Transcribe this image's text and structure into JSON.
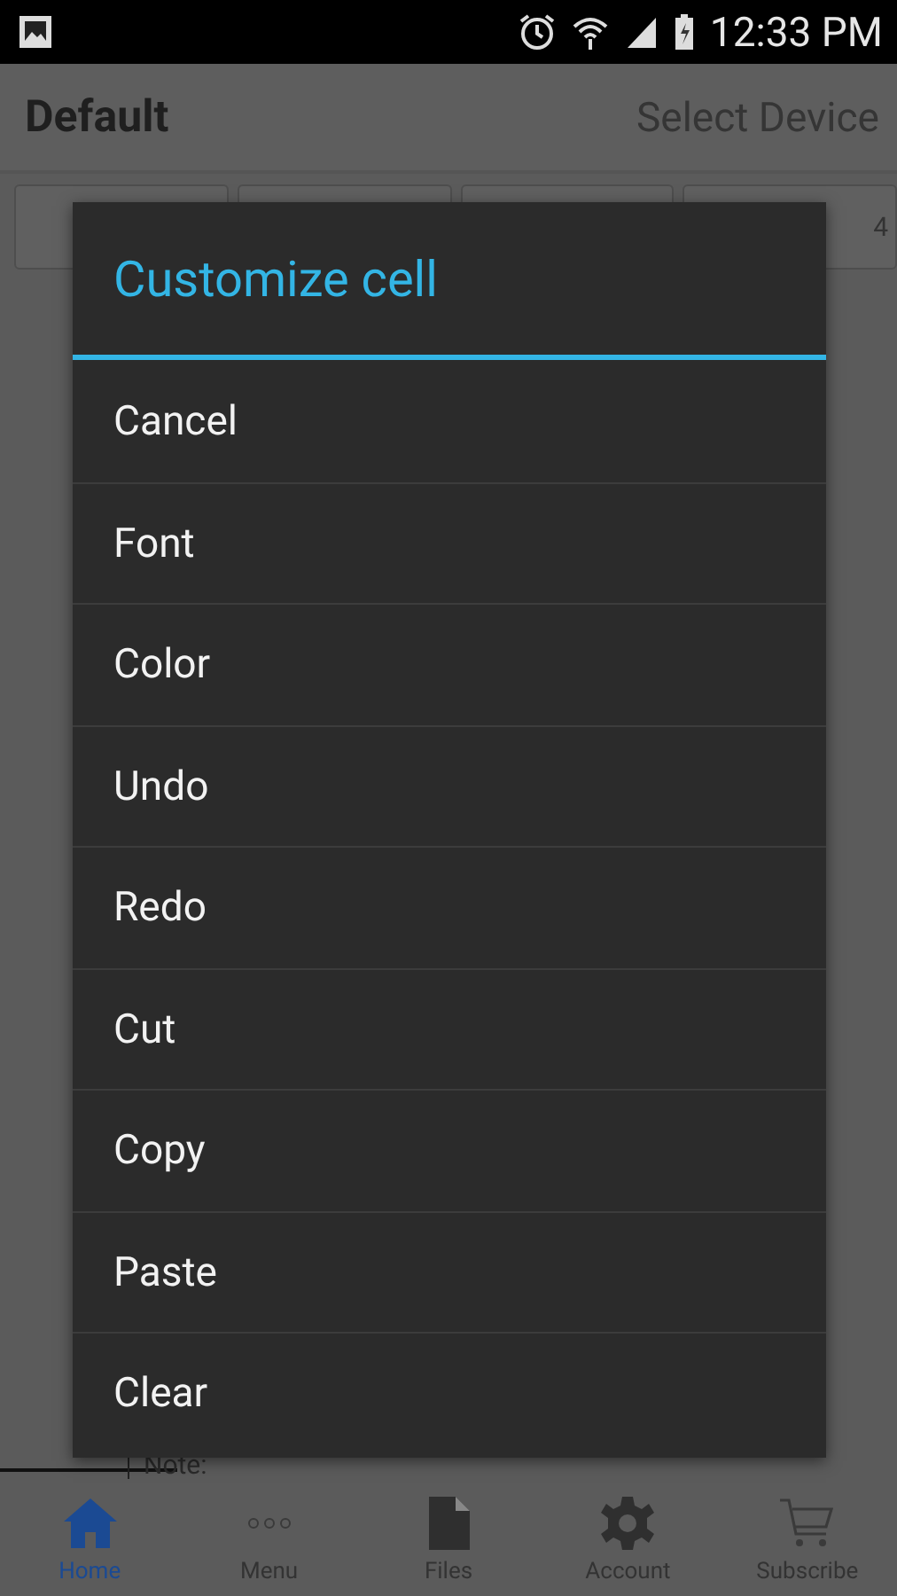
{
  "status_bar": {
    "time": "12:33 PM"
  },
  "app_bar": {
    "title": "Default",
    "action": "Select Device"
  },
  "cell_buttons": [
    {
      "kind": "blank"
    },
    {
      "kind": "blank"
    },
    {
      "kind": "blank"
    },
    {
      "kind": "labeled",
      "label": "4"
    }
  ],
  "note": {
    "label": "Note:"
  },
  "dialog": {
    "title": "Customize cell",
    "items": [
      "Cancel",
      "Font",
      "Color",
      "Undo",
      "Redo",
      "Cut",
      "Copy",
      "Paste",
      "Clear"
    ]
  },
  "bottom_nav": [
    {
      "label": "Home",
      "selected": true
    },
    {
      "label": "Menu",
      "selected": false
    },
    {
      "label": "Files",
      "selected": false
    },
    {
      "label": "Account",
      "selected": false
    },
    {
      "label": "Subscribe",
      "selected": false
    }
  ]
}
